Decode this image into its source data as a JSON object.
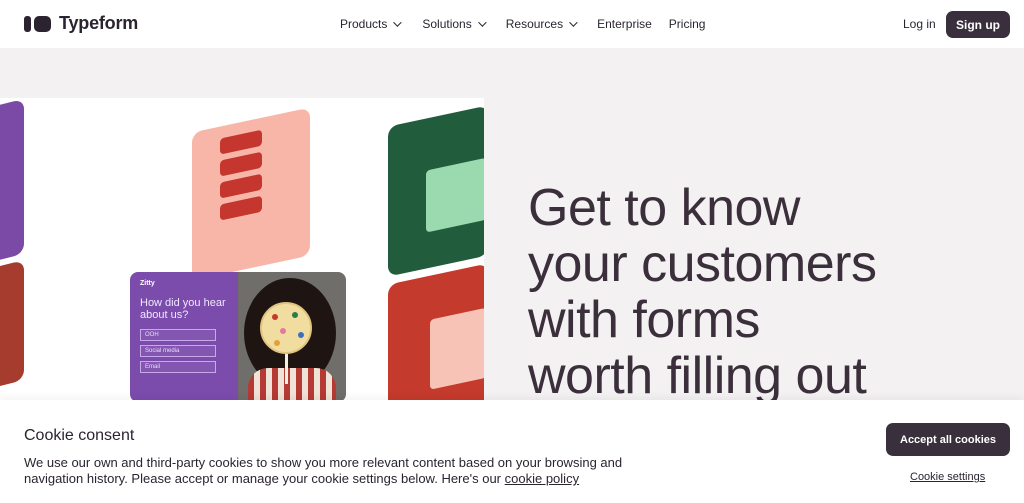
{
  "brand": {
    "name": "Typeform"
  },
  "nav": {
    "items": [
      {
        "label": "Products",
        "dropdown": true
      },
      {
        "label": "Solutions",
        "dropdown": true
      },
      {
        "label": "Resources",
        "dropdown": true
      },
      {
        "label": "Enterprise",
        "dropdown": false
      },
      {
        "label": "Pricing",
        "dropdown": false
      }
    ],
    "login_label": "Log in",
    "signup_label": "Sign up"
  },
  "hero": {
    "lines": [
      "Get to know",
      "your customers",
      "with forms",
      "worth filling out"
    ]
  },
  "form_preview": {
    "brand": "Zitty",
    "question": "How did you hear about us?",
    "options": [
      "OOH",
      "Social media",
      "Email"
    ]
  },
  "cookie": {
    "title": "Cookie consent",
    "body": "We use our own and third-party cookies to show you more relevant content based on your browsing and navigation history. Please accept or manage your cookie settings below. Here's our",
    "policy_link": "cookie policy",
    "accept_label": "Accept all cookies",
    "settings_label": "Cookie settings"
  },
  "colors": {
    "accent": "#3a2f3c",
    "page_bg": "#f3f1f2",
    "purple": "#7b4aa6",
    "pink": "#f8b6a8",
    "green": "#215c3c",
    "red": "#c43a2c"
  }
}
